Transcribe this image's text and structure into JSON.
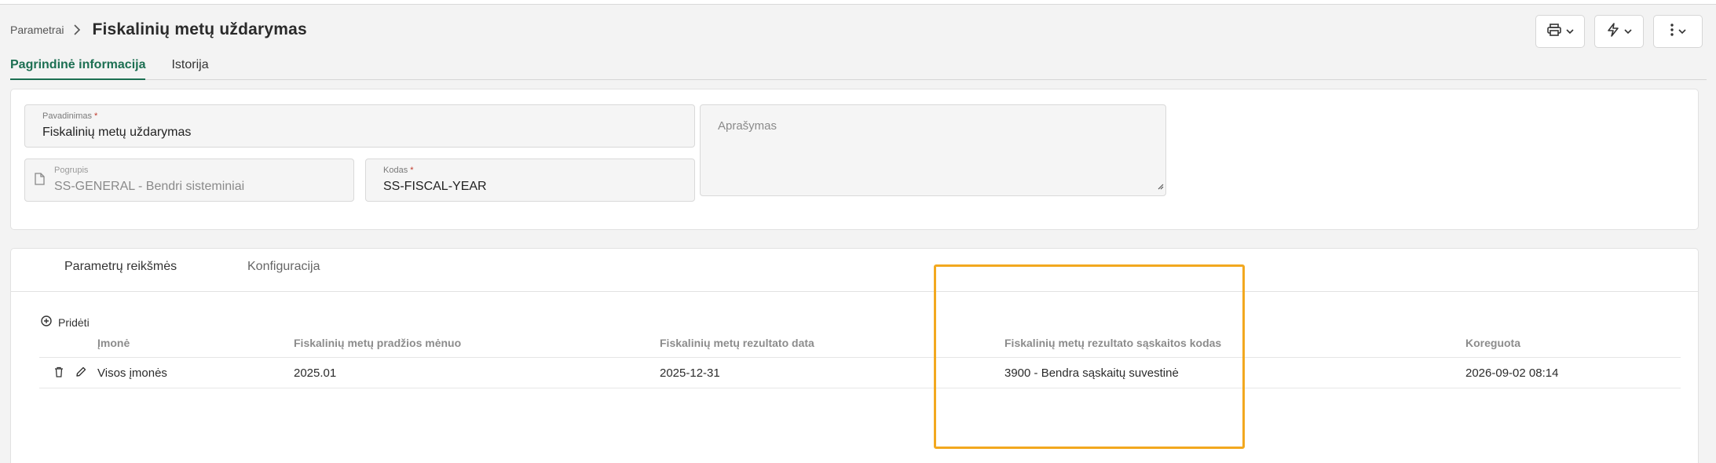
{
  "breadcrumb": {
    "parent": "Parametrai",
    "title": "Fiskalinių metų uždarymas"
  },
  "tabs": [
    {
      "label": "Pagrindinė informacija",
      "active": true
    },
    {
      "label": "Istorija",
      "active": false
    }
  ],
  "form": {
    "name": {
      "label": "Pavadinimas",
      "required_mark": "*",
      "value": "Fiskalinių metų uždarymas"
    },
    "description": {
      "placeholder": "Aprašymas",
      "value": ""
    },
    "subgroup": {
      "label": "Pogrupis",
      "value": "SS-GENERAL - Bendri sisteminiai"
    },
    "code": {
      "label": "Kodas",
      "required_mark": "*",
      "value": "SS-FISCAL-YEAR"
    }
  },
  "subtabs": [
    {
      "label": "Parametrų reikšmės",
      "active": true
    },
    {
      "label": "Konfiguracija",
      "active": false
    }
  ],
  "add_label": "Pridėti",
  "table": {
    "columns": [
      "Įmonė",
      "Fiskalinių metų pradžios mėnuo",
      "Fiskalinių metų rezultato data",
      "Fiskalinių metų rezultato sąskaitos kodas",
      "Koreguota"
    ],
    "rows": [
      [
        "Visos įmonės",
        "2025.01",
        "2025-12-31",
        "3900 - Bendra sąskaitų suvestinė",
        "2026-09-02 08:14"
      ]
    ]
  },
  "colors": {
    "accent": "#1c6f52",
    "highlight": "#f2a81f"
  },
  "icons": [
    "chevron-right-icon",
    "printer-icon",
    "lightning-icon",
    "more-vertical-icon",
    "chevron-down-icon",
    "document-icon",
    "add-circle-icon",
    "trash-icon",
    "edit-icon",
    "resize-icon"
  ]
}
